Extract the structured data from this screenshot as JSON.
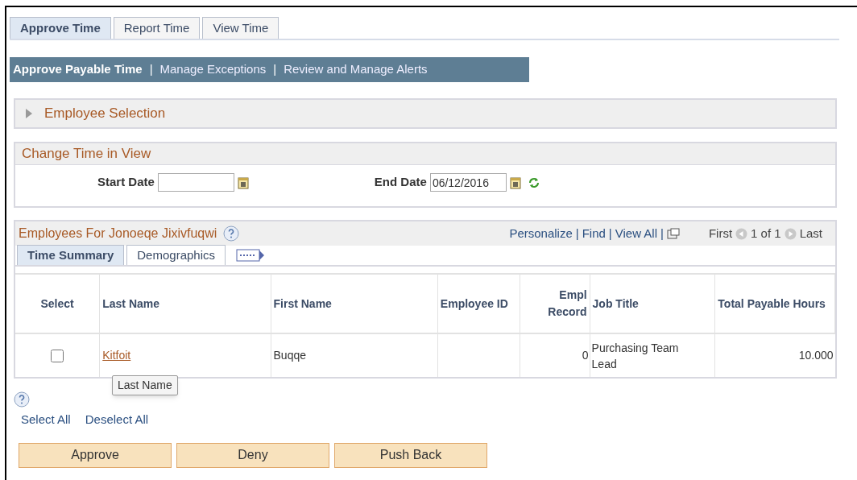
{
  "tabs": [
    {
      "label": "Approve Time",
      "selected": true
    },
    {
      "label": "Report Time",
      "selected": false
    },
    {
      "label": "View Time",
      "selected": false
    }
  ],
  "subnav_separator": "|",
  "subnav": [
    {
      "label": "Approve Payable Time",
      "selected": true
    },
    {
      "label": "Manage Exceptions",
      "selected": false
    },
    {
      "label": "Review and Manage Alerts",
      "selected": false
    }
  ],
  "employee_selection": {
    "title": "Employee Selection",
    "expanded": false
  },
  "change_time": {
    "title": "Change Time in View",
    "start_label": "Start Date",
    "end_label": "End Date",
    "end_value": "06/12/2016"
  },
  "grid": {
    "title": "Employees For Jonoeqe Jixivfuqwi",
    "link_separator": "|",
    "links": [
      "Personalize",
      "Find",
      "View All"
    ],
    "first": "First",
    "count": "1 of 1",
    "last": "Last",
    "tabs": [
      {
        "label": "Time Summary",
        "selected": true
      },
      {
        "label": "Demographics",
        "selected": false
      }
    ],
    "columns": [
      "Select",
      "Last Name",
      "First Name",
      "Employee ID",
      "Empl Record",
      "Job Title",
      "Total Payable Hours"
    ],
    "rows": [
      {
        "checked": false,
        "last_name": "Kitfoit",
        "first_name": "Buqqe",
        "employee_id": "",
        "empl_record": "0",
        "job_title": "Purchasing Team Lead",
        "hours": "10.000"
      }
    ]
  },
  "tooltip": "Last Name",
  "select_all": "Select All",
  "deselect_all": "Deselect All",
  "buttons": [
    "Approve",
    "Deny",
    "Push Back"
  ]
}
